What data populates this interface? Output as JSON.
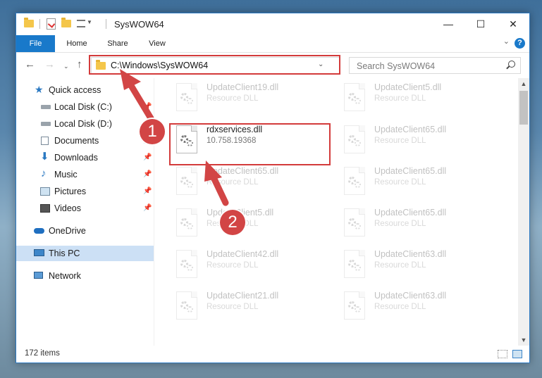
{
  "window": {
    "title": "SysWOW64",
    "minimize": "—",
    "maximize": "☐",
    "close": "✕"
  },
  "ribbon": {
    "tabs": [
      "File",
      "Home",
      "Share",
      "View"
    ],
    "help": "?"
  },
  "nav": {
    "address": "C:\\Windows\\SysWOW64",
    "search_placeholder": "Search SysWOW64"
  },
  "sidebar": {
    "items": [
      {
        "label": "Quick access",
        "icon": "star-icon"
      },
      {
        "label": "Local Disk (C:)",
        "icon": "drive-icon"
      },
      {
        "label": "Local Disk (D:)",
        "icon": "drive-icon"
      },
      {
        "label": "Documents",
        "icon": "documents-icon"
      },
      {
        "label": "Downloads",
        "icon": "download-icon"
      },
      {
        "label": "Music",
        "icon": "music-icon"
      },
      {
        "label": "Pictures",
        "icon": "pictures-icon"
      },
      {
        "label": "Videos",
        "icon": "videos-icon"
      },
      {
        "label": "OneDrive",
        "icon": "cloud-icon"
      },
      {
        "label": "This PC",
        "icon": "computer-icon"
      },
      {
        "label": "Network",
        "icon": "network-icon"
      }
    ]
  },
  "files": {
    "left": [
      {
        "name": "UpdateClient19.dll",
        "sub": "Resource DLL"
      },
      {
        "name": "rdxservices.dll",
        "sub": "10.758.19368"
      },
      {
        "name": "UpdateClient65.dll",
        "sub": "Resource DLL"
      },
      {
        "name": "UpdateClient5.dll",
        "sub": "Resource DLL"
      },
      {
        "name": "UpdateClient42.dll",
        "sub": "Resource DLL"
      },
      {
        "name": "UpdateClient21.dll",
        "sub": "Resource DLL"
      }
    ],
    "right": [
      {
        "name": "UpdateClient5.dll",
        "sub": "Resource DLL"
      },
      {
        "name": "UpdateClient65.dll",
        "sub": "Resource DLL"
      },
      {
        "name": "UpdateClient65.dll",
        "sub": "Resource DLL"
      },
      {
        "name": "UpdateClient65.dll",
        "sub": "Resource DLL"
      },
      {
        "name": "UpdateClient63.dll",
        "sub": "Resource DLL"
      },
      {
        "name": "UpdateClient63.dll",
        "sub": "Resource DLL"
      }
    ]
  },
  "status": {
    "item_count": "172 items"
  },
  "annotations": {
    "step1": "1",
    "step2": "2",
    "color": "#d24545"
  }
}
